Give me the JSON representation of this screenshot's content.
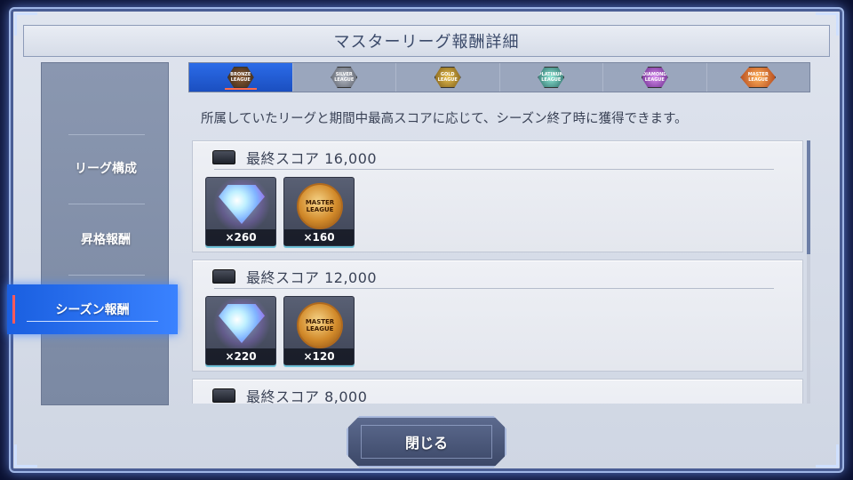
{
  "dialog": {
    "title": "マスターリーグ報酬詳細",
    "description": "所属していたリーグと期間中最高スコアに応じて、シーズン終了時に獲得できます。",
    "close_label": "閉じる"
  },
  "sidebar": {
    "items": [
      {
        "label": "リーグ構成",
        "active": false
      },
      {
        "label": "昇格報酬",
        "active": false
      },
      {
        "label": "シーズン報酬",
        "active": true
      }
    ]
  },
  "league_tabs": [
    {
      "badge_text": "BRONZE LEAGUE",
      "active": true
    },
    {
      "badge_text": "SILVER LEAGUE",
      "active": false
    },
    {
      "badge_text": "GOLD LEAGUE",
      "active": false
    },
    {
      "badge_text": "PLATINUM LEAGUE",
      "active": false
    },
    {
      "badge_text": "DIAMOND LEAGUE",
      "active": false
    },
    {
      "badge_text": "MASTER LEAGUE",
      "active": false
    }
  ],
  "rewards": [
    {
      "title": "最終スコア 16,000",
      "items": [
        {
          "icon": "diamond-icon",
          "qty": "×260"
        },
        {
          "icon": "master-league-medal-icon",
          "qty": "×160",
          "medal_text": "MASTER LEAGUE"
        }
      ]
    },
    {
      "title": "最終スコア 12,000",
      "items": [
        {
          "icon": "diamond-icon",
          "qty": "×220"
        },
        {
          "icon": "master-league-medal-icon",
          "qty": "×120",
          "medal_text": "MASTER LEAGUE"
        }
      ]
    },
    {
      "title": "最終スコア 8,000",
      "items": []
    }
  ],
  "colors": {
    "accent_blue": "#2b6be8",
    "highlight_red": "#ff5a5a",
    "panel_bg": "#dfe4ee"
  }
}
